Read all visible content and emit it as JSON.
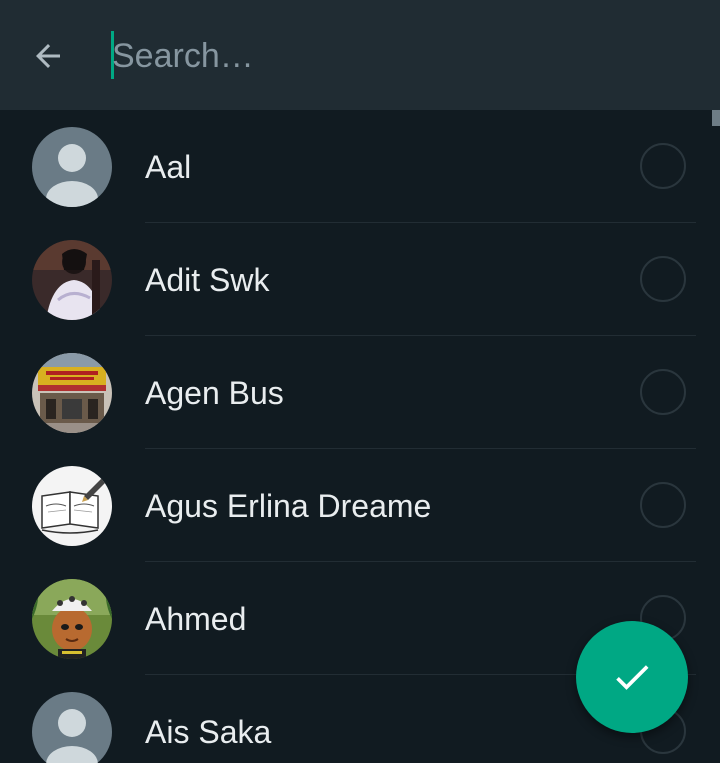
{
  "search": {
    "placeholder": "Search…",
    "value": ""
  },
  "icons": {
    "back": "arrow-left-icon",
    "confirm": "check-icon",
    "default_avatar": "person-icon"
  },
  "colors": {
    "accent": "#00a884",
    "header_bg": "#202c33",
    "list_bg": "#111b21",
    "text_primary": "#e9edef",
    "text_secondary": "#8696a0"
  },
  "contacts": [
    {
      "name": "Aal",
      "avatar": "default",
      "selected": false
    },
    {
      "name": "Adit Swk",
      "avatar": "photo",
      "selected": false
    },
    {
      "name": "Agen Bus",
      "avatar": "photo",
      "selected": false
    },
    {
      "name": "Agus Erlina Dreame",
      "avatar": "photo",
      "selected": false
    },
    {
      "name": "Ahmed",
      "avatar": "photo",
      "selected": false
    },
    {
      "name": "Ais Saka",
      "avatar": "default",
      "selected": false
    }
  ]
}
